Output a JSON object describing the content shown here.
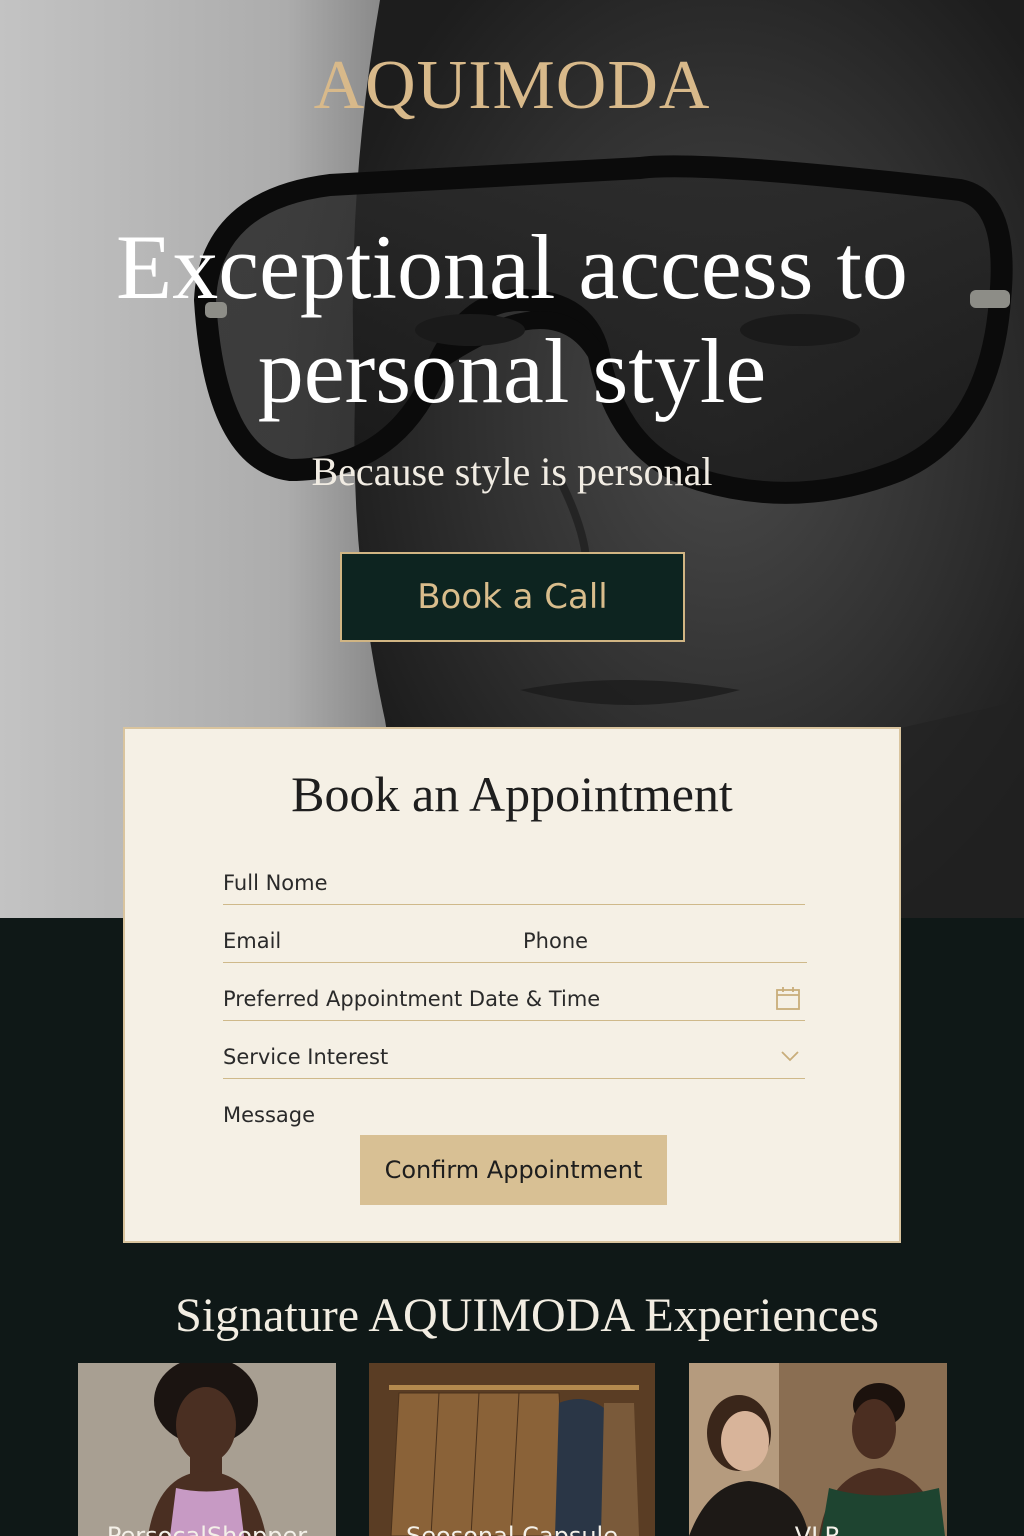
{
  "brand": {
    "name": "AQUIMODA"
  },
  "hero": {
    "headline": "Exceptional access to personal style",
    "subheadline": "Because style is personal",
    "cta_label": "Book a Call"
  },
  "form": {
    "title": "Book an Appointment",
    "fields": {
      "full_name": "Full Nome",
      "email": "Email",
      "phone": "Phone",
      "date_time": "Preferred Appointment Date & Time",
      "service": "Service Interest",
      "message": "Message"
    },
    "submit_label": "Confirm Appointment",
    "icons": {
      "date_time": "calendar-icon",
      "service": "chevron-down-icon"
    }
  },
  "experiences": {
    "title": "Signature AQUIMODA Experiences",
    "cards": [
      {
        "label": "PersocalShopper"
      },
      {
        "label": "Seosonal Capsule"
      },
      {
        "label": "VLR"
      }
    ]
  },
  "colors": {
    "gold": "#d8b98a",
    "dark_green": "#0d2420",
    "cream": "#f5f0e5",
    "page_dark": "#0f1817",
    "button_tan": "#d8c094"
  }
}
